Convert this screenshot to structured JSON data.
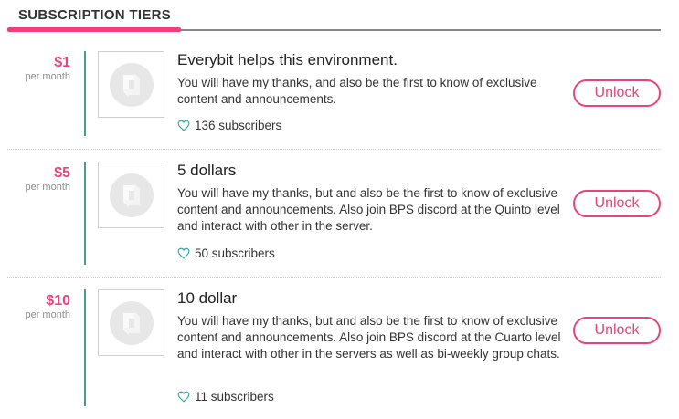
{
  "header": {
    "title": "SUBSCRIPTION TIERS"
  },
  "tiers": [
    {
      "price": "$1",
      "period": "per month",
      "title": "Everybit helps this environment.",
      "description": "You will have my thanks, and also be the first to know of exclusive content and announcements.",
      "subscribers": "136 subscribers",
      "button": "Unlock"
    },
    {
      "price": "$5",
      "period": "per month",
      "title": "5 dollars",
      "description": "You will have my thanks, but and also be the first to know of exclusive content and announcements. Also join BPS discord at the Quinto level and interact with other in the server.",
      "subscribers": "50 subscribers",
      "button": "Unlock"
    },
    {
      "price": "$10",
      "period": "per month",
      "title": "10 dollar",
      "description": "You will have my thanks, but and also be the first to know of exclusive content and announcements. Also join BPS discord at the Cuarto level and interact with other in the servers as well as bi-weekly group chats.",
      "subscribers": "11 subscribers",
      "button": "Unlock"
    }
  ],
  "colors": {
    "accent": "#e8437a",
    "divider": "#4c9c8e",
    "heart": "#3aa6a0"
  },
  "icons": {
    "subscribers": "heart-outline-icon",
    "thumbnail": "logo-placeholder-icon"
  }
}
